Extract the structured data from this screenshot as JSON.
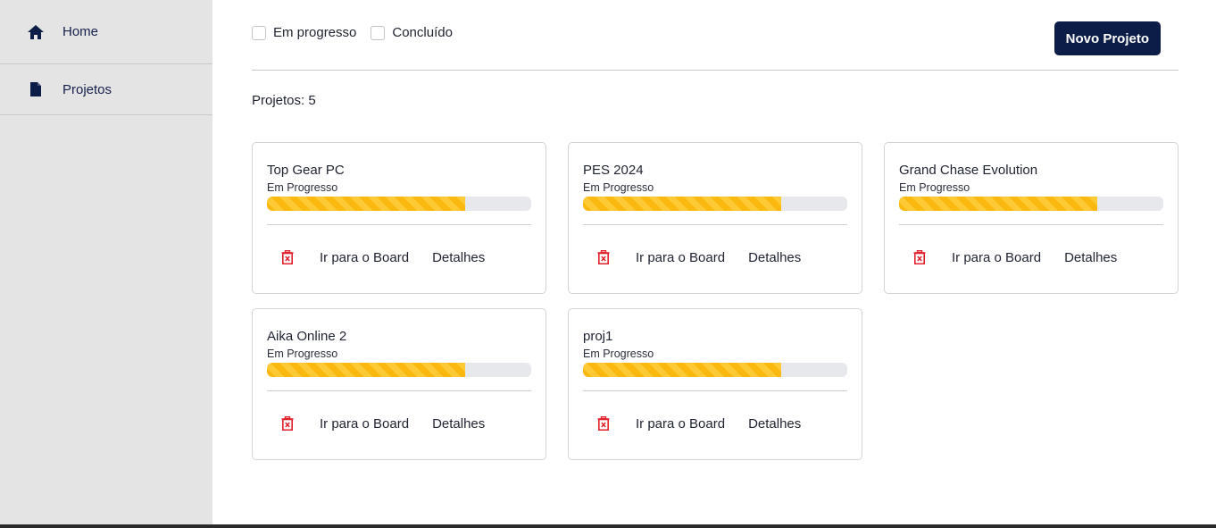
{
  "sidebar": {
    "items": [
      {
        "label": "Home",
        "icon": "home-icon"
      },
      {
        "label": "Projetos",
        "icon": "document-icon"
      }
    ]
  },
  "filters": [
    {
      "label": "Em progresso",
      "checked": false
    },
    {
      "label": "Concluído",
      "checked": false
    }
  ],
  "new_project_label": "Novo Projeto",
  "count_label": "Projetos: 5",
  "actions": {
    "board_label": "Ir para o Board",
    "details_label": "Detalhes",
    "delete_icon": "trash-icon"
  },
  "projects": [
    {
      "title": "Top Gear PC",
      "status": "Em Progresso",
      "progress": 0.75
    },
    {
      "title": "PES 2024",
      "status": "Em Progresso",
      "progress": 0.75
    },
    {
      "title": "Grand Chase Evolution",
      "status": "Em Progresso",
      "progress": 0.75
    },
    {
      "title": "Aika Online 2",
      "status": "Em Progresso",
      "progress": 0.75
    },
    {
      "title": "proj1",
      "status": "Em Progresso",
      "progress": 0.75
    }
  ],
  "colors": {
    "accent": "#0c1d47",
    "progress": "#fbb80f",
    "delete": "#e0202a",
    "sidebar_bg": "#e4e4e5"
  }
}
